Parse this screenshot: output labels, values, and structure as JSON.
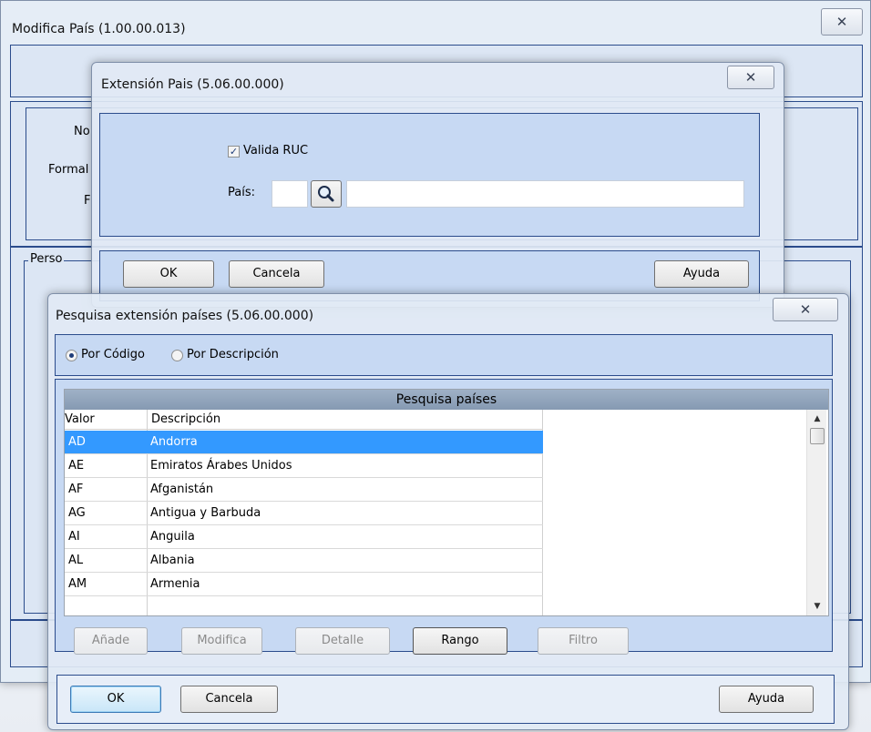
{
  "main_window": {
    "title": "Modifica País (1.00.00.013)",
    "labels": [
      "No",
      "Formal",
      "F",
      "Perso"
    ]
  },
  "extension_dialog": {
    "title": "Extensión Pais (5.06.00.000)",
    "checkbox_label": "Valida RUC",
    "checkbox_checked": true,
    "country_label": "País:",
    "country_code": "",
    "country_name": "",
    "buttons": {
      "ok": "OK",
      "cancel": "Cancela",
      "help": "Ayuda"
    }
  },
  "search_dialog": {
    "title": "Pesquisa extensión países (5.06.00.000)",
    "radio_by_code": "Por Código",
    "radio_by_description": "Por Descripción",
    "selected_radio": "by_code",
    "grid": {
      "caption": "Pesquisa países",
      "columns": [
        "Valor",
        "Descripción"
      ],
      "rows": [
        {
          "valor": "AD",
          "descripcion": "Andorra",
          "selected": true
        },
        {
          "valor": "AE",
          "descripcion": "Emiratos Árabes Unidos"
        },
        {
          "valor": "AF",
          "descripcion": "Afganistán"
        },
        {
          "valor": "AG",
          "descripcion": "Antigua y Barbuda"
        },
        {
          "valor": "AI",
          "descripcion": "Anguila"
        },
        {
          "valor": "AL",
          "descripcion": "Albania"
        },
        {
          "valor": "AM",
          "descripcion": "Armenia"
        }
      ]
    },
    "toolbar": {
      "add": "Añade",
      "modify": "Modifica",
      "detail": "Detalle",
      "range": "Rango",
      "filter": "Filtro"
    },
    "buttons": {
      "ok": "OK",
      "cancel": "Cancela",
      "help": "Ayuda"
    }
  },
  "colors": {
    "selection": "#3399ff",
    "panel_border": "#2b4c8c",
    "panel_fill": "#c7d9f3"
  }
}
